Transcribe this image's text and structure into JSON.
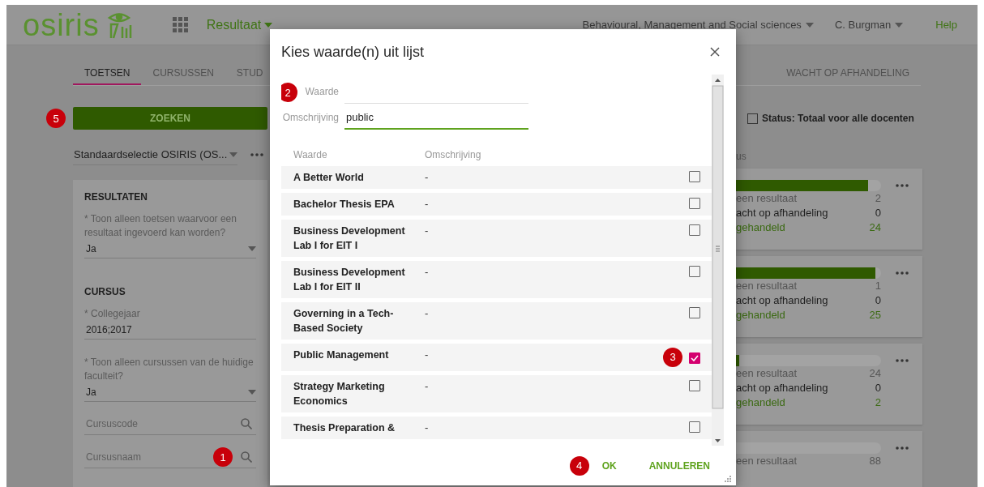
{
  "header": {
    "logo": "osiris",
    "menu": "Resultaat",
    "faculty": "Behavioural, Management and Social sciences",
    "user": "C. Burgman",
    "help": "Help"
  },
  "tabs": [
    {
      "label": "TOETSEN",
      "selected": true
    },
    {
      "label": "CURSUSSEN",
      "selected": false
    },
    {
      "label": "STUD",
      "selected": false
    }
  ],
  "tabs_right": [
    {
      "label": "WACHT OP AFHANDELING",
      "selected": false
    }
  ],
  "search_button": {
    "label": "ZOEKEN",
    "marker": "5"
  },
  "selection": {
    "value": "Standaardselectie OSIRIS (OS..."
  },
  "filter_panel": {
    "sections": [
      {
        "title": "RESULTATEN",
        "fields": [
          {
            "kind": "select",
            "label": "* Toon alleen toetsen waarvoor een resultaat ingevoerd kan worden?",
            "value": "Ja"
          }
        ]
      },
      {
        "title": "CURSUS",
        "fields": [
          {
            "kind": "text",
            "label": "* Collegejaar",
            "value": "2016;2017"
          },
          {
            "kind": "select",
            "label": "* Toon alleen cursussen van de huidige faculteit?",
            "value": "Ja"
          },
          {
            "kind": "search",
            "placeholder": "Cursuscode"
          },
          {
            "kind": "search",
            "placeholder": "Cursusnaam",
            "marker": "1"
          }
        ]
      }
    ]
  },
  "status_checkbox": {
    "label": "Status: Totaal voor alle docenten",
    "checked": false
  },
  "status_heading": "us",
  "cards": [
    {
      "level": 0.91,
      "rows": [
        {
          "kind": "none",
          "label": "een resultaat",
          "value": "2"
        },
        {
          "kind": "waiting",
          "label": "acht op afhandeling",
          "value": "0"
        },
        {
          "kind": "done",
          "label": "gehandeld",
          "value": "24"
        }
      ]
    },
    {
      "level": 0.96,
      "rows": [
        {
          "kind": "none",
          "label": "een resultaat",
          "value": "1"
        },
        {
          "kind": "waiting",
          "label": "acht op afhandeling",
          "value": "0"
        },
        {
          "kind": "done",
          "label": "gehandeld",
          "value": "25"
        }
      ]
    },
    {
      "level": 0.02,
      "rows": [
        {
          "kind": "none",
          "label": "een resultaat",
          "value": "24"
        },
        {
          "kind": "waiting",
          "label": "acht op afhandeling",
          "value": "0"
        },
        {
          "kind": "done",
          "label": "gehandeld",
          "value": "2"
        }
      ]
    },
    {
      "rows": [
        {
          "kind": "none",
          "label": "een resultaat",
          "value": "88"
        }
      ]
    }
  ],
  "dialog": {
    "title": "Kies waarde(n) uit lijst",
    "marker": "2",
    "fields": [
      {
        "label": "Waarde",
        "focused": false
      },
      {
        "label": "Omschrijving",
        "value": "public",
        "focused": true
      }
    ],
    "columns": [
      "Waarde",
      "Omschrijving"
    ],
    "rows": [
      {
        "waarde": "A Better World",
        "omschrijving": "-",
        "checked": false
      },
      {
        "waarde": "Bachelor Thesis EPA",
        "omschrijving": "-",
        "checked": false
      },
      {
        "waarde": "Business Development Lab I for EIT I",
        "omschrijving": "-",
        "checked": false
      },
      {
        "waarde": "Business Development Lab I for EIT II",
        "omschrijving": "-",
        "checked": false
      },
      {
        "waarde": "Governing in a Tech-Based Society",
        "omschrijving": "-",
        "checked": false
      },
      {
        "waarde": "Public Management",
        "omschrijving": "-",
        "checked": true,
        "marker": "3"
      },
      {
        "waarde": "Strategy Marketing Economics",
        "omschrijving": "-",
        "checked": false
      },
      {
        "waarde": "Thesis Preparation &",
        "omschrijving": "-",
        "checked": false
      }
    ],
    "buttons": [
      {
        "kind": "ok",
        "label": "OK",
        "marker": "4"
      },
      {
        "kind": "cancel",
        "label": "ANNULEREN"
      }
    ]
  }
}
